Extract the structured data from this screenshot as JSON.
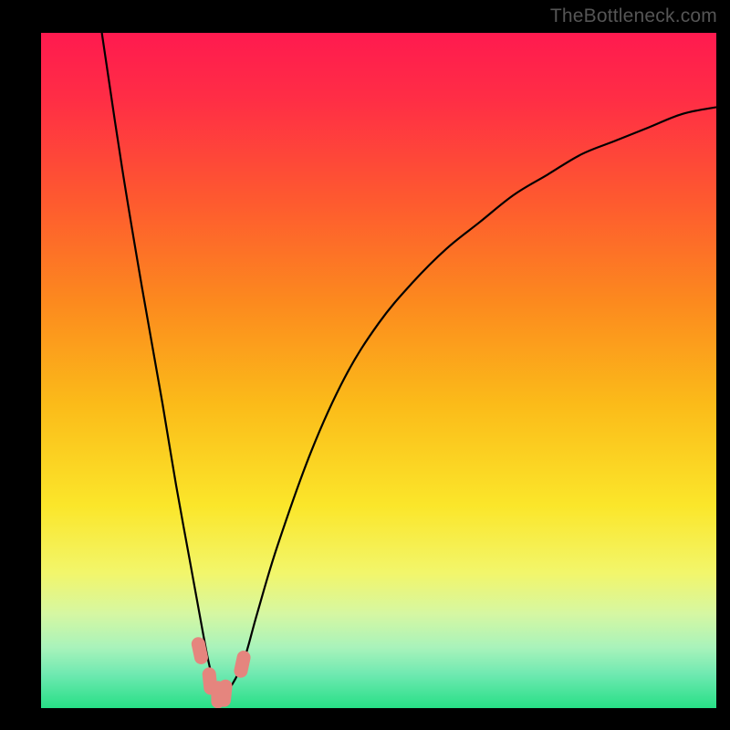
{
  "watermark": "TheBottleneck.com",
  "colors": {
    "frame": "#000000",
    "curve": "#000000",
    "marker": "#e5857e",
    "gradient_stops": [
      {
        "offset": 0.0,
        "color": "#ff1a4f"
      },
      {
        "offset": 0.1,
        "color": "#ff2e45"
      },
      {
        "offset": 0.25,
        "color": "#fe5a2f"
      },
      {
        "offset": 0.4,
        "color": "#fc8a1e"
      },
      {
        "offset": 0.55,
        "color": "#fbbb19"
      },
      {
        "offset": 0.7,
        "color": "#fbe62a"
      },
      {
        "offset": 0.8,
        "color": "#f2f66b"
      },
      {
        "offset": 0.86,
        "color": "#d6f7a2"
      },
      {
        "offset": 0.91,
        "color": "#a9f3bb"
      },
      {
        "offset": 0.95,
        "color": "#6fe9b1"
      },
      {
        "offset": 1.0,
        "color": "#27df86"
      }
    ]
  },
  "chart_data": {
    "type": "line",
    "title": "",
    "xlabel": "",
    "ylabel": "",
    "xlim": [
      0,
      100
    ],
    "ylim": [
      0,
      100
    ],
    "series": [
      {
        "name": "bottleneck-curve",
        "x": [
          9,
          12,
          15,
          18,
          20,
          22,
          24,
          25,
          26,
          27,
          28,
          30,
          32,
          35,
          40,
          45,
          50,
          55,
          60,
          65,
          70,
          75,
          80,
          85,
          90,
          95,
          100
        ],
        "y": [
          100,
          80,
          62,
          45,
          33,
          22,
          11,
          6,
          3,
          2,
          3,
          7,
          14,
          24,
          38,
          49,
          57,
          63,
          68,
          72,
          76,
          79,
          82,
          84,
          86,
          88,
          89
        ]
      }
    ],
    "markers": {
      "name": "highlight-points",
      "x": [
        23.5,
        25.0,
        26.2,
        27.2,
        29.8
      ],
      "y": [
        8.5,
        4.0,
        2.0,
        2.2,
        6.5
      ]
    }
  }
}
